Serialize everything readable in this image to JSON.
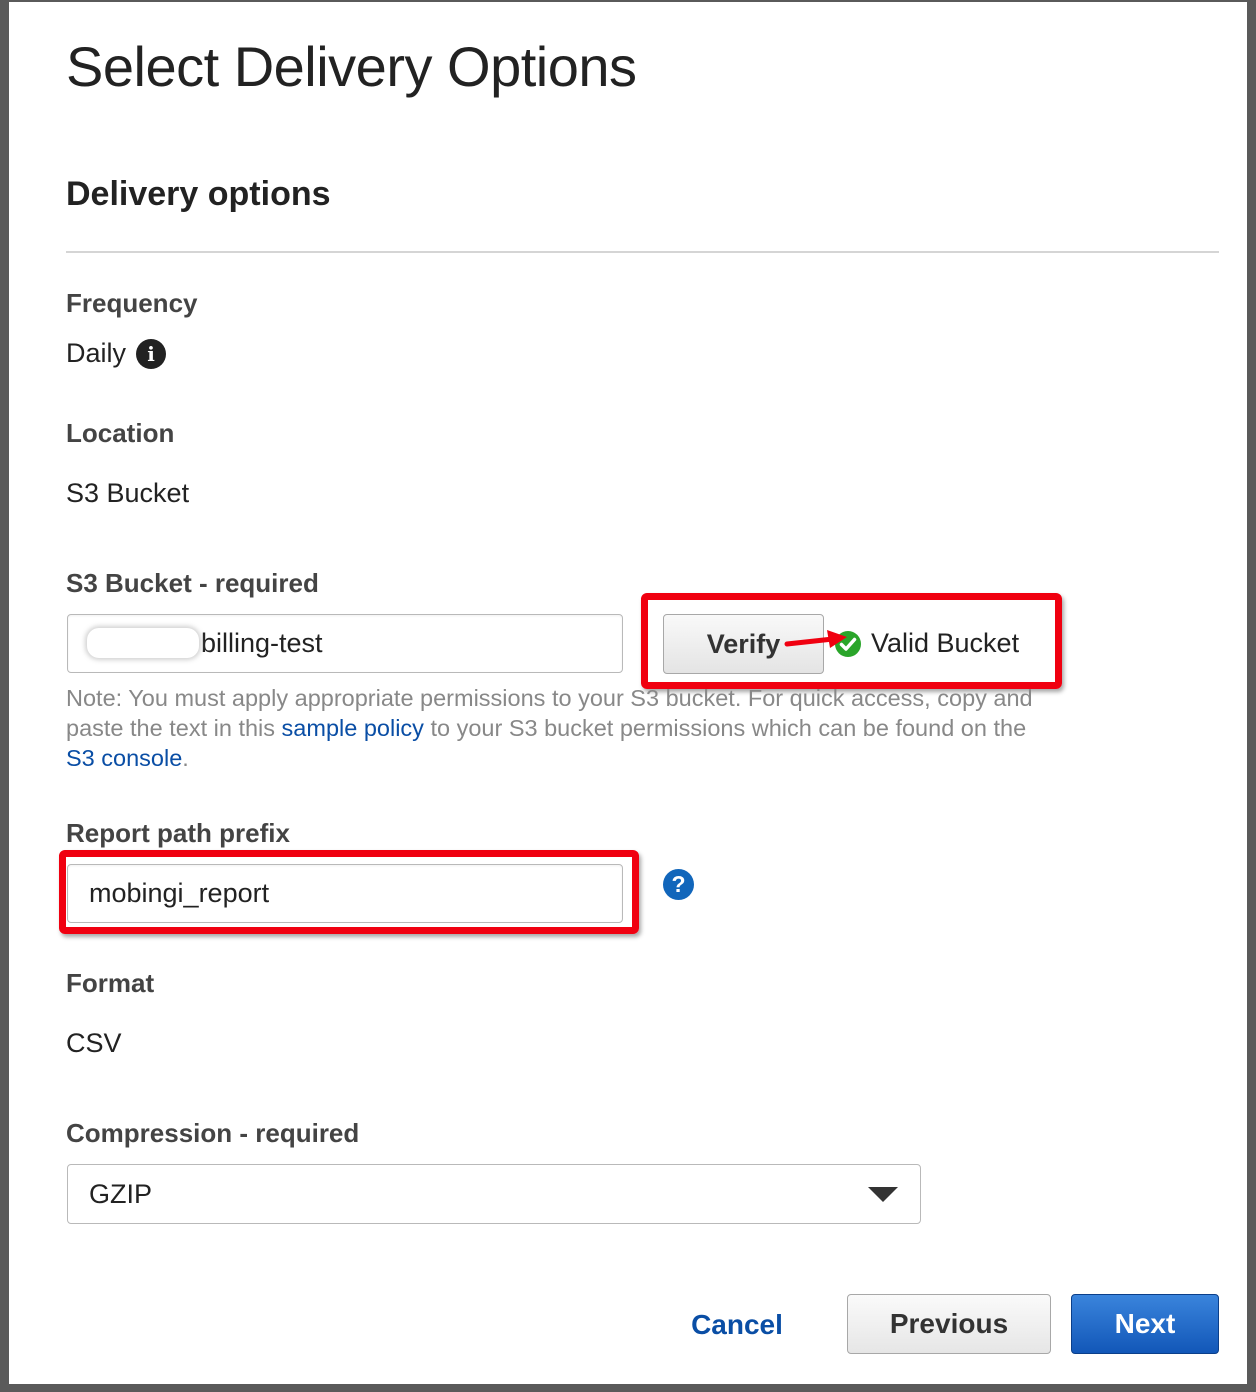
{
  "page": {
    "title": "Select Delivery Options",
    "section_title": "Delivery options"
  },
  "frequency": {
    "label": "Frequency",
    "value": "Daily",
    "icon": "info-icon"
  },
  "location": {
    "label": "Location",
    "value": "S3 Bucket"
  },
  "s3_bucket": {
    "label": "S3 Bucket - required",
    "value": "billing-test",
    "verify_label": "Verify",
    "status_text": "Valid Bucket",
    "status_icon": "check-circle-icon",
    "status_color": "#2aa52a"
  },
  "note": {
    "part1": "Note: You must apply appropriate permissions to your S3 bucket. For quick access, copy and paste the text in this ",
    "link1": "sample policy",
    "part2": " to your S3 bucket permissions which can be found on the ",
    "link2": "S3 console",
    "part3": "."
  },
  "report_path": {
    "label": "Report path prefix",
    "value": "mobingi_report",
    "help_icon": "?"
  },
  "format": {
    "label": "Format",
    "value": "CSV"
  },
  "compression": {
    "label": "Compression - required",
    "selected": "GZIP"
  },
  "footer": {
    "cancel_label": "Cancel",
    "previous_label": "Previous",
    "next_label": "Next"
  },
  "colors": {
    "annotation_red": "#f00010",
    "link_blue": "#0a4ea5",
    "primary_blue": "#1257b8"
  }
}
